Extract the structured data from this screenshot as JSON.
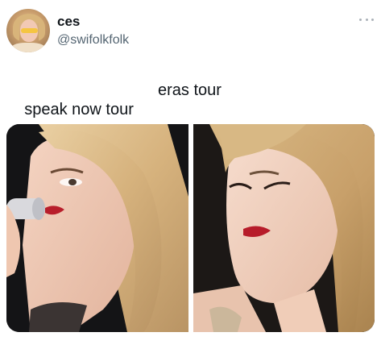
{
  "author": {
    "display_name": "ces",
    "handle": "@swifolkfolk",
    "avatar_icon": "profile-photo"
  },
  "menu": {
    "icon": "more-horizontal-icon"
  },
  "tweet": {
    "text_left": "speak now tour",
    "text_right": "eras tour"
  },
  "media": {
    "photos": [
      {
        "subject": "photo-speak-now-tour"
      },
      {
        "subject": "photo-eras-tour"
      }
    ]
  },
  "colors": {
    "name": "#0f1419",
    "handle": "#536471",
    "background": "#ffffff"
  }
}
